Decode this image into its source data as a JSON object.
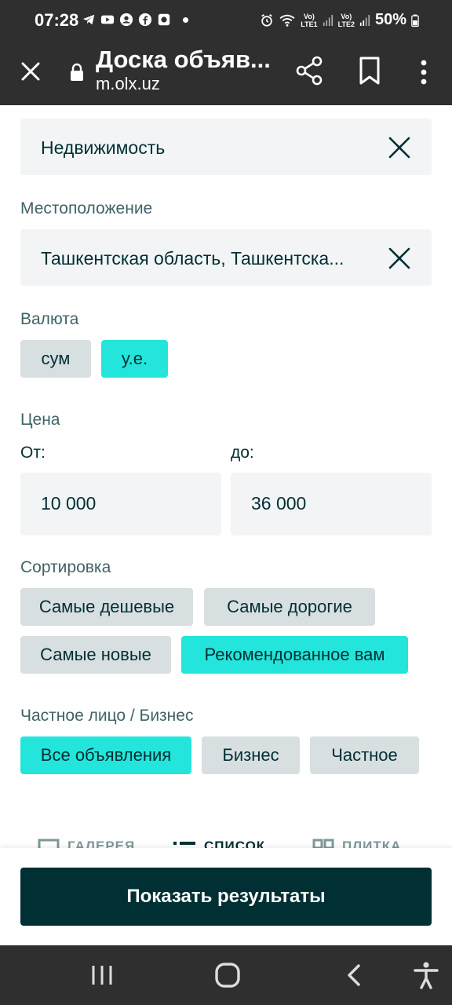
{
  "status_bar": {
    "time": "07:28",
    "battery": "50%",
    "sim1": "LTE1",
    "sim2": "LTE2"
  },
  "browser": {
    "title": "Доска объяв...",
    "url": "m.olx.uz"
  },
  "filters": {
    "category": {
      "value": "Недвижимость"
    },
    "location": {
      "label": "Местоположение",
      "value": "Ташкентская область, Ташкентска..."
    },
    "currency": {
      "label": "Валюта",
      "options": [
        {
          "label": "сум",
          "active": false
        },
        {
          "label": "у.е.",
          "active": true
        }
      ]
    },
    "price": {
      "label": "Цена",
      "from_label": "От:",
      "to_label": "до:",
      "from_value": "10 000",
      "to_value": "36 000"
    },
    "sort": {
      "label": "Сортировка",
      "options": [
        {
          "label": "Самые дешевые",
          "active": false
        },
        {
          "label": "Самые дорогие",
          "active": false
        },
        {
          "label": "Самые новые",
          "active": false
        },
        {
          "label": "Рекомендованное вам",
          "active": true
        }
      ]
    },
    "seller": {
      "label": "Частное лицо / Бизнес",
      "options": [
        {
          "label": "Все объявления",
          "active": true
        },
        {
          "label": "Бизнес",
          "active": false
        },
        {
          "label": "Частное",
          "active": false
        }
      ]
    }
  },
  "view_modes": [
    {
      "label": "ГАЛЕРЕЯ",
      "active": false
    },
    {
      "label": "СПИСОК",
      "active": true
    },
    {
      "label": "ПЛИТКА",
      "active": false
    }
  ],
  "action": {
    "show_results": "Показать результаты"
  },
  "colors": {
    "accent": "#23e5db",
    "primary": "#002f34",
    "chip": "#d8dfe0",
    "field": "#f2f4f5",
    "bar": "#2f2f2f"
  }
}
